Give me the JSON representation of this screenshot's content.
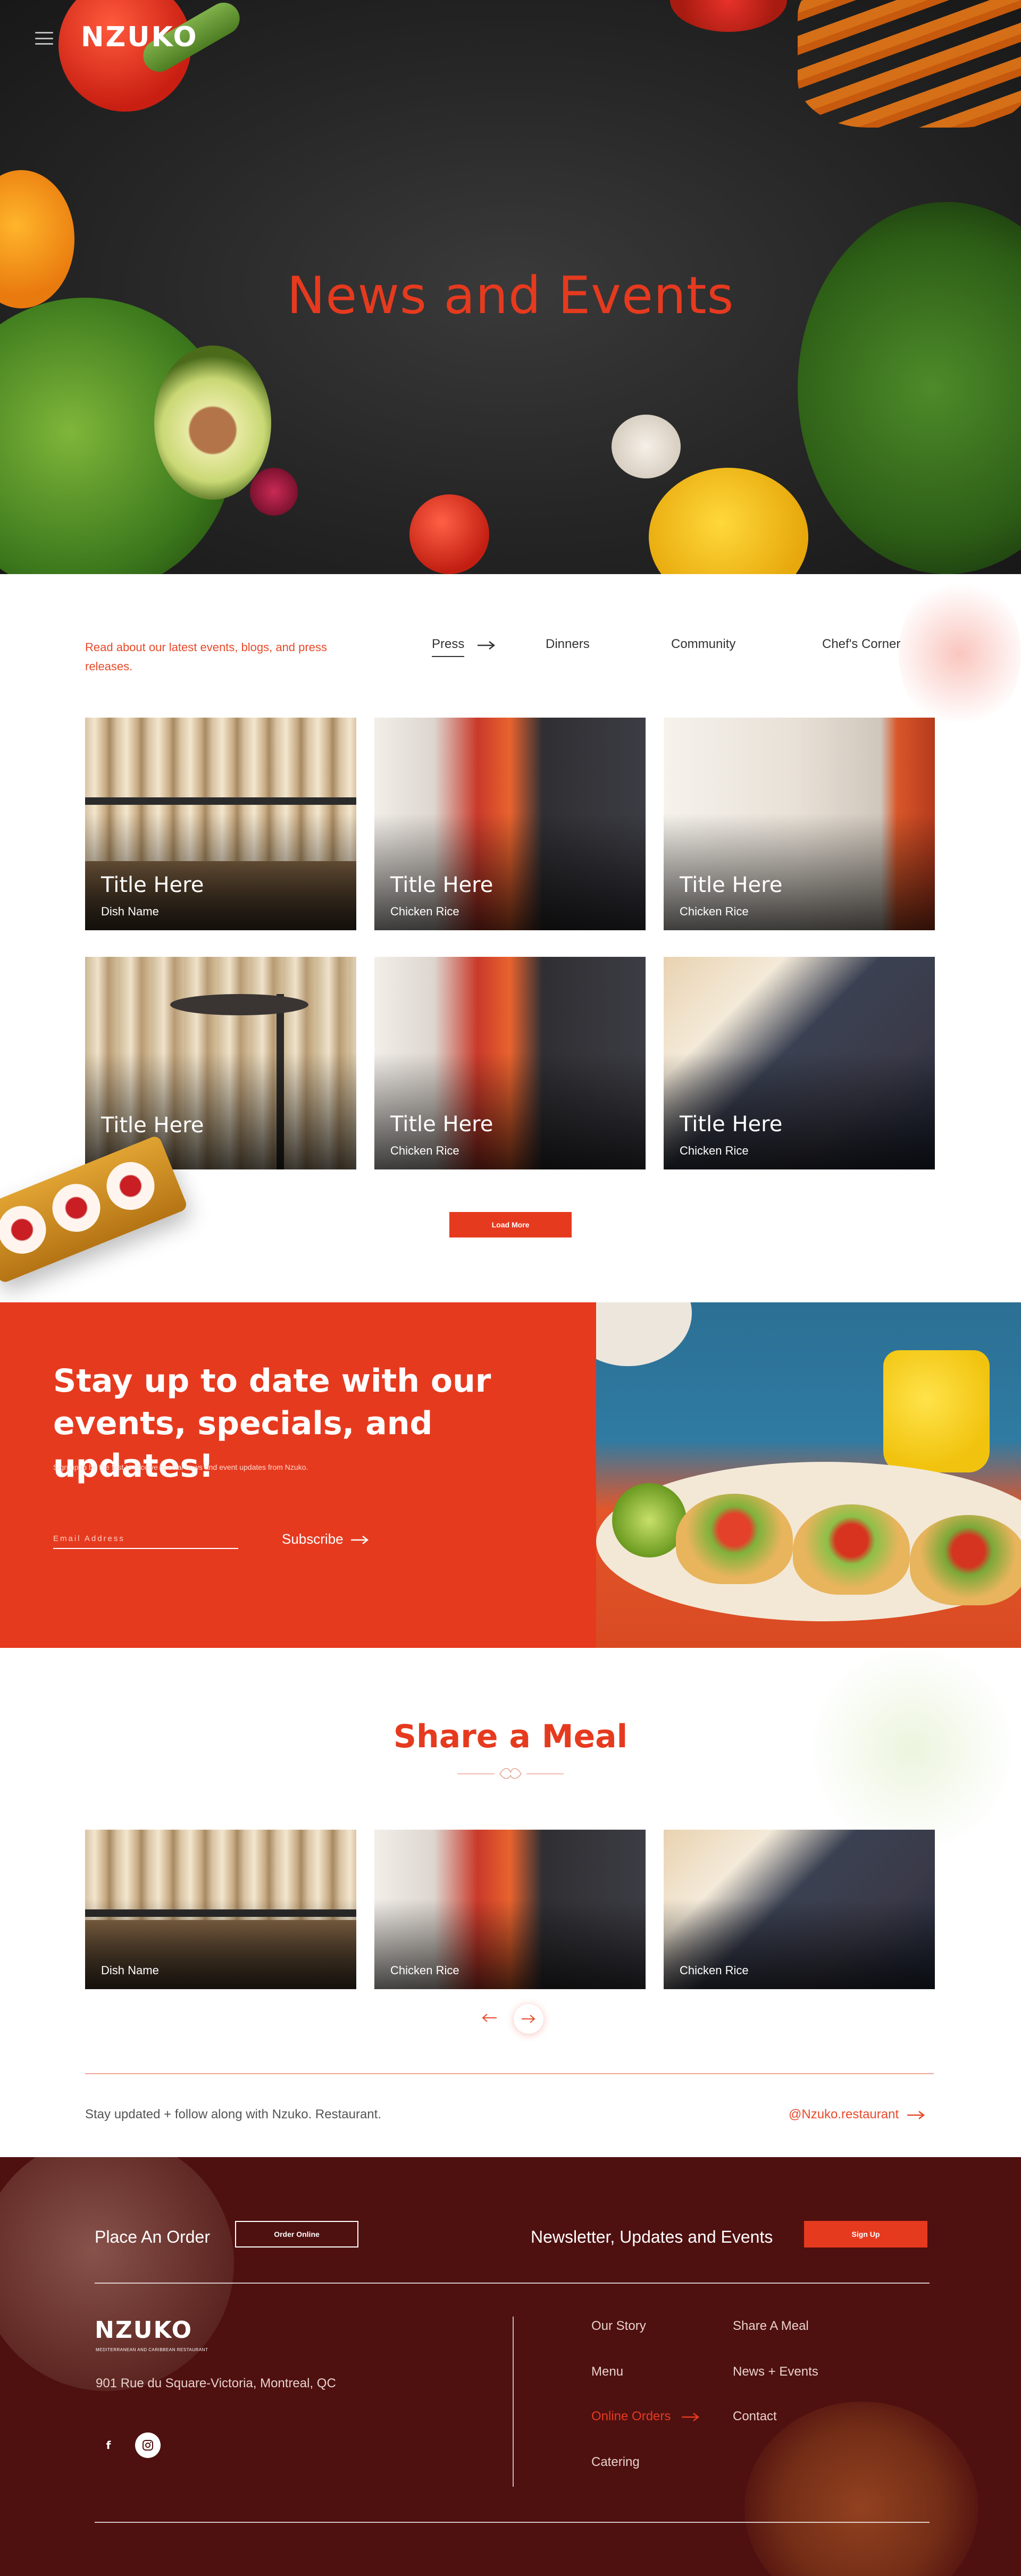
{
  "brand": {
    "logo_text": "NZUKO",
    "logo_tagline": "MEDITERRANEAN AND CARIBBEAN RESTAURANT"
  },
  "hero": {
    "title": "News and Events"
  },
  "news": {
    "intro": "Read about our latest events, blogs, and press releases.",
    "tabs": [
      "Press",
      "Dinners",
      "Community",
      "Chef's Corner"
    ],
    "active_tab": "Press",
    "cards": [
      {
        "title": "Title Here",
        "subtitle": "Dish Name"
      },
      {
        "title": "Title Here",
        "subtitle": "Chicken Rice"
      },
      {
        "title": "Title Here",
        "subtitle": "Chicken Rice"
      },
      {
        "title": "Title Here",
        "subtitle": ""
      },
      {
        "title": "Title Here",
        "subtitle": "Chicken Rice"
      },
      {
        "title": "Title Here",
        "subtitle": "Chicken Rice"
      }
    ],
    "load_more_label": "Load More"
  },
  "newsletter": {
    "title": "Stay up to date with our events, specials, and updates!",
    "subtitle": "Sign up to be the first to receive special news and event updates from Nzuko.",
    "email_placeholder": "Email Address",
    "subscribe_label": "Subscribe"
  },
  "share": {
    "title": "Share a Meal",
    "cards": [
      {
        "subtitle": "Dish Name"
      },
      {
        "subtitle": "Chicken Rice"
      },
      {
        "subtitle": "Chicken Rice"
      }
    ],
    "follow_text": "Stay updated + follow along with Nzuko. Restaurant.",
    "follow_handle": "@Nzuko.restaurant"
  },
  "footer": {
    "order_heading": "Place An Order",
    "order_button": "Order Online",
    "newsletter_heading": "Newsletter, Updates and Events",
    "signup_button": "Sign Up",
    "address": "901 Rue du Square-Victoria, Montreal, QC",
    "links_col1": [
      "Our Story",
      "Menu",
      "Online Orders",
      "Catering"
    ],
    "links_col2": [
      "Share A Meal",
      "News + Events",
      "Contact"
    ],
    "highlighted_link": "Online Orders"
  },
  "colors": {
    "accent": "#e63a1f",
    "footer_bg": "#4f1010",
    "hero_bg": "#262626"
  },
  "icons": [
    "menu-icon",
    "arrow-right-icon",
    "arrow-left-icon",
    "facebook-icon",
    "instagram-icon",
    "ornament-icon"
  ]
}
